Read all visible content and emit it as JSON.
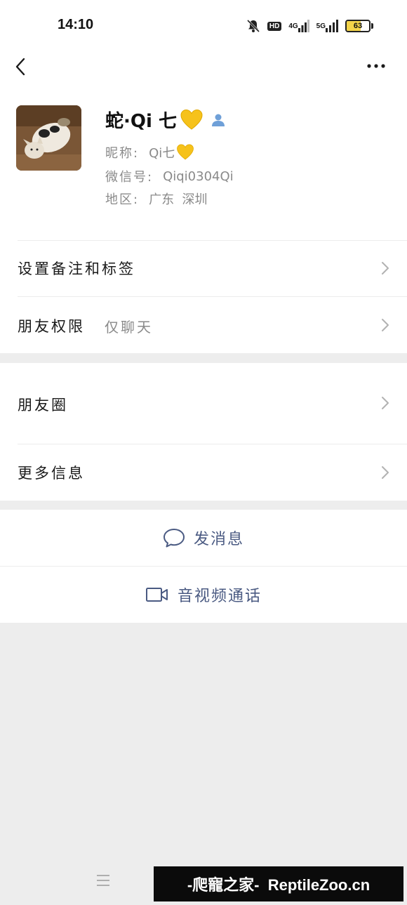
{
  "status_bar": {
    "time": "14:10",
    "hd_label": "HD",
    "net1_label": "4G",
    "net2_label": "5G",
    "battery_level": 63,
    "battery_text": "63",
    "battery_color": "#f3d44a"
  },
  "nav": {
    "back_icon": "chevron-left-icon",
    "more_icon": "more-dots-icon"
  },
  "profile": {
    "display_name": "蛇·Qi 七",
    "nickname_label": "昵称:",
    "nickname_value": "Qi七",
    "wechat_id_label": "微信号:",
    "wechat_id_value": "Qiqi0304Qi",
    "region_label": "地区:",
    "region_value": "广东  深圳"
  },
  "rows": {
    "remark_tags": "设置备注和标签",
    "friend_permission": "朋友权限",
    "friend_permission_value": "仅聊天",
    "moments": "朋友圈",
    "more_info": "更多信息"
  },
  "actions": {
    "send_message": "发消息",
    "video_call": "音视频通话"
  },
  "watermark": {
    "text": "-爬寵之家-  ReptileZoo.cn"
  },
  "colors": {
    "accent": "#4a5a82",
    "background": "#ededed",
    "heart": "#f6c21b"
  }
}
